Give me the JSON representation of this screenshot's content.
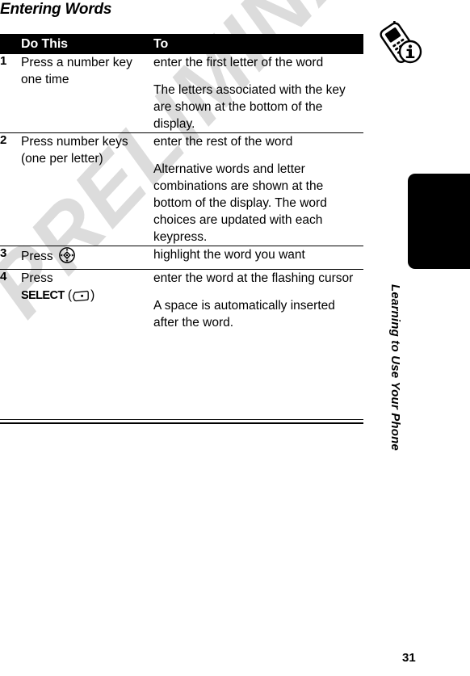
{
  "document": {
    "page_title": "Entering Words",
    "page_number": "31",
    "watermark": "PRELIMINARY"
  },
  "sidebar": {
    "tab_icon": "phone-info-icon",
    "chapter_label": "Learning to Use Your Phone"
  },
  "table": {
    "headers": {
      "number": "",
      "do_this": "Do This",
      "to": "To"
    },
    "rows": [
      {
        "number": "1",
        "do_this": [
          "Press a number key one time"
        ],
        "to": [
          "enter the first letter of the word",
          "The letters associated with the key are shown at the bottom of the display."
        ]
      },
      {
        "number": "2",
        "do_this": [
          "Press number keys (one per letter)"
        ],
        "to": [
          "enter the rest of the word",
          "Alternative words and letter combinations are shown at the bottom of the display. The word choices are updated with each keypress."
        ]
      },
      {
        "number": "3",
        "do_this_prefix": "Press ",
        "do_this_icon": "navigation-key-icon",
        "to": [
          "highlight the word you want"
        ]
      },
      {
        "number": "4",
        "do_this_prefix": "Press ",
        "do_this_softkey": "SELECT",
        "do_this_icon": "left-soft-key-icon",
        "to": [
          "enter the word at the flashing cursor",
          "A space is automatically inserted after the word."
        ]
      }
    ]
  },
  "colors": {
    "header_bg": "#000000",
    "header_text": "#ffffff",
    "body_text": "#000000",
    "watermark": "#dcdcdc",
    "page_bg": "#ffffff"
  }
}
